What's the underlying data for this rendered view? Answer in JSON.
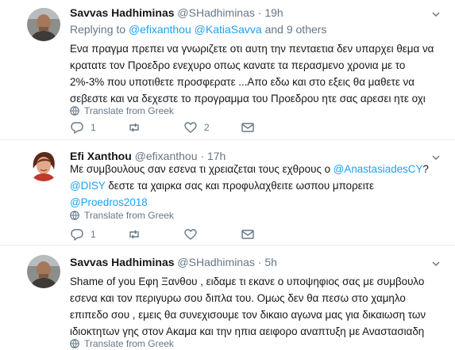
{
  "tweets": [
    {
      "name": "Savvas Hadhiminas",
      "handle": "@SHadhiminas",
      "dot": "·",
      "time": "19h",
      "reply_prefix": "Replying to",
      "reply_user1": "@efixanthou",
      "reply_user2": "@KatiaSavva",
      "reply_suffix": "and 9 others",
      "lines": [
        "Ενα πραγμα πρεπει να γνωριζετε οτι αυτη την πενταετια δεν υπαρχει θεμα να",
        "κρατατε τον Προεδρο ενεχυρο οπως κανατε τα περασμενο χρονια με το",
        "2%-3% που υποτιθετε προσφερατε ...Απο εδω και στο εξεις θα μαθετε να",
        "σεβεστε και να δεχεστε το προγραμμα του Προεδρου ητε σας αρεσει ητε οχι"
      ],
      "translate": "Translate from Greek",
      "reply_count": "1",
      "retweet_count": "",
      "like_count": "2",
      "icons": [
        "avatar-man",
        "chevron-down-icon",
        "globe-icon",
        "reply-icon",
        "retweet-icon",
        "heart-icon",
        "message-icon"
      ]
    },
    {
      "name": "Efi Xanthou",
      "handle": "@efixanthou",
      "dot": "·",
      "time": "17h",
      "line1_text": "Με συμβουλους σαν εσενα τι χρειαζεται τους εχθρους ο ",
      "line1_link": "@AnastasiadesCY",
      "line1_end": "?",
      "line2_link": "@DISY",
      "line2_text": " δεστε τα χαιρκα σας και προφυλαχθειτε ωσπου μπορειτε",
      "line3_link": "@Proedros2018",
      "translate": "Translate from Greek",
      "reply_count": "1",
      "retweet_count": "",
      "like_count": ""
    },
    {
      "name": "Savvas Hadhiminas",
      "handle": "@SHadhiminas",
      "dot": "·",
      "time": "5h",
      "lines": [
        "Shame of you Εφη Ξανθου , ειδαμε τι εκανε ο υποψηφιος σας  με συμβουλο",
        "εσενα και τον περιγυρω σου διπλα του. Ομως δεν θα πεσω στο χαμηλο",
        "επιπεδο σου , εμεις θα συνεχισουμε τον δικαιο αγωνα μας για δικαιωση των",
        "ιδιοκτητων γης στον Ακαμα και την ηπια αειφορο αναπτυξη με Αναστασιαδη"
      ],
      "translate": "Translate from Greek"
    }
  ],
  "colors": {
    "link": "#1da1f2",
    "muted": "#657786",
    "text": "#14171a",
    "divider": "#e6ecf0"
  }
}
